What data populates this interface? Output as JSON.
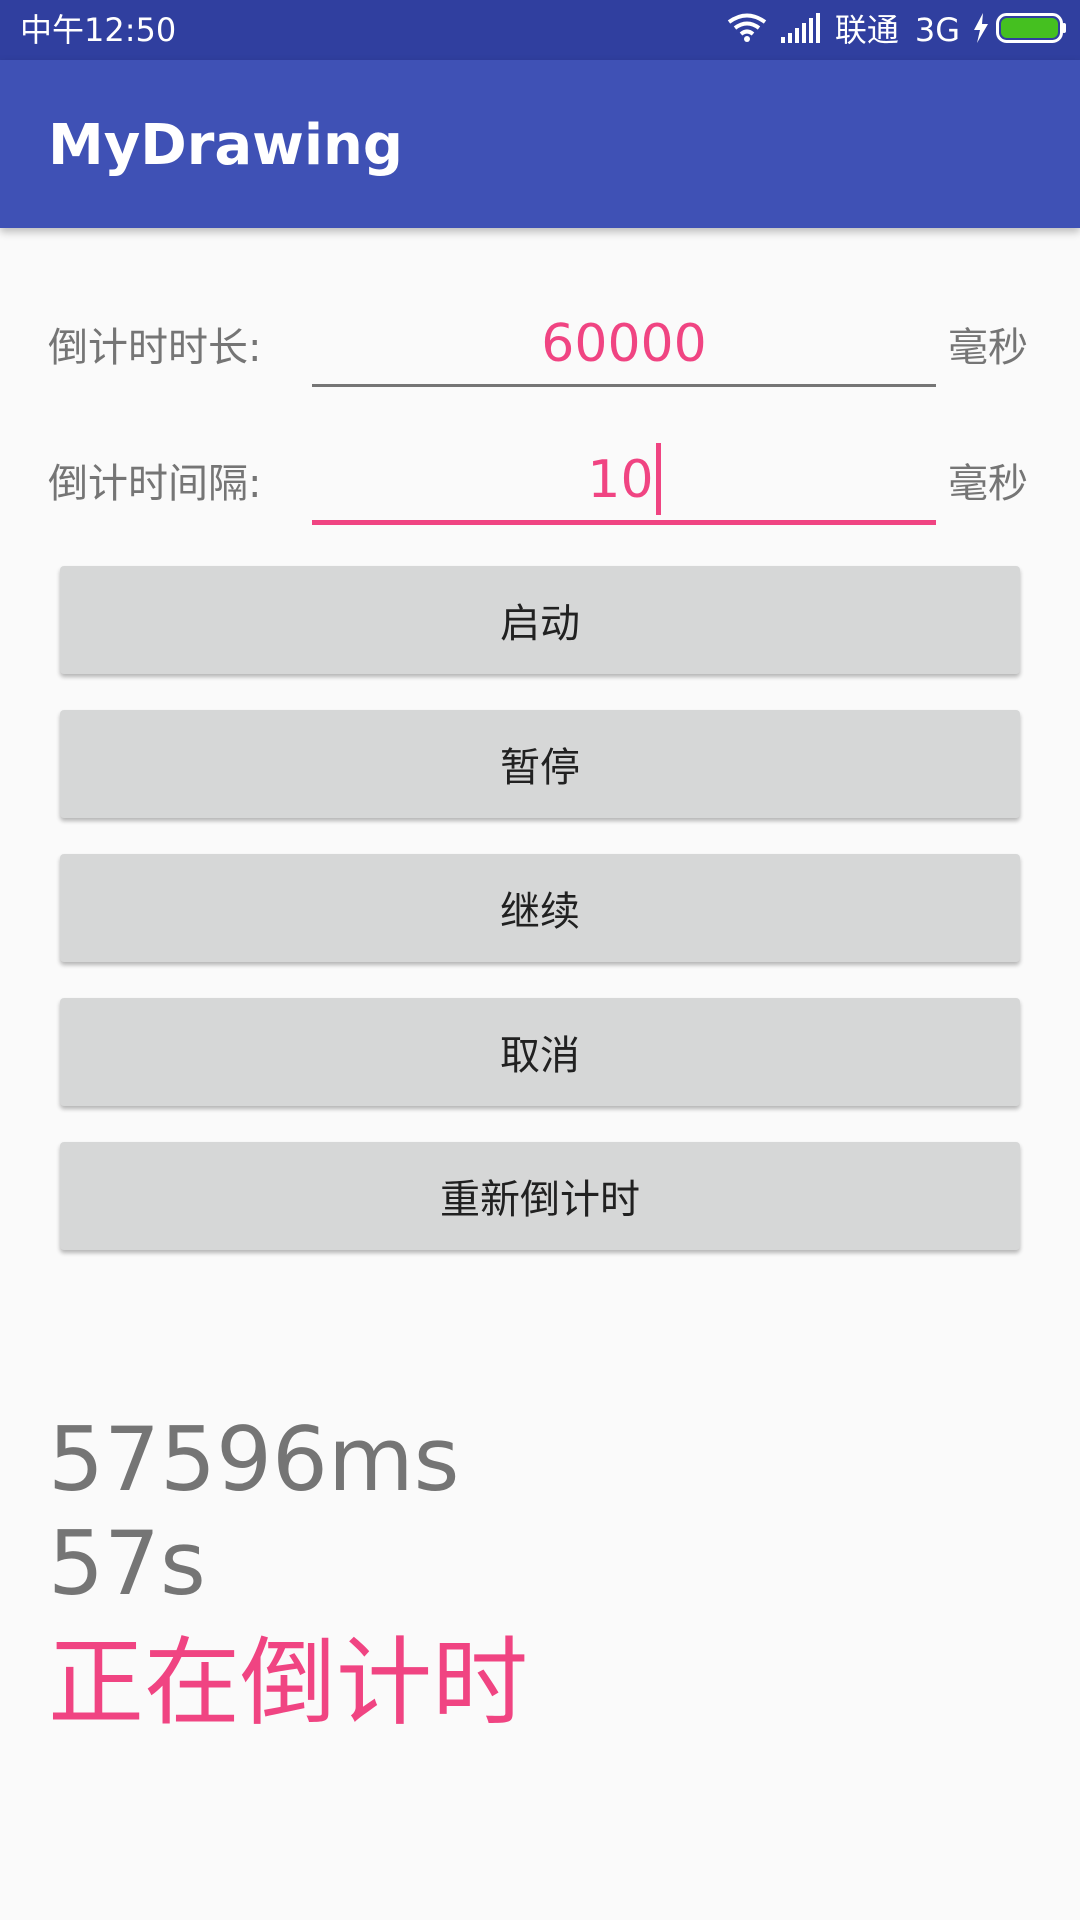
{
  "status_bar": {
    "time": "中午12:50",
    "carrier": "联通",
    "network": "3G",
    "icons": [
      "wifi-icon",
      "signal-icon",
      "charging-icon",
      "battery-icon"
    ]
  },
  "app_bar": {
    "title": "MyDrawing"
  },
  "form": {
    "duration": {
      "label": "倒计时时长:",
      "value": "60000",
      "unit": "毫秒"
    },
    "interval": {
      "label": "倒计时间隔:",
      "value": "10",
      "unit": "毫秒"
    }
  },
  "buttons": {
    "start": "启动",
    "pause": "暂停",
    "resume": "继续",
    "cancel": "取消",
    "restart": "重新倒计时"
  },
  "output": {
    "remaining_ms": "57596ms",
    "remaining_s": "57s",
    "status": "正在倒计时"
  },
  "colors": {
    "status_bar": "#303f9f",
    "app_bar": "#3f51b5",
    "accent": "#f04482",
    "background": "#fafafa",
    "button": "#d6d7d7"
  }
}
